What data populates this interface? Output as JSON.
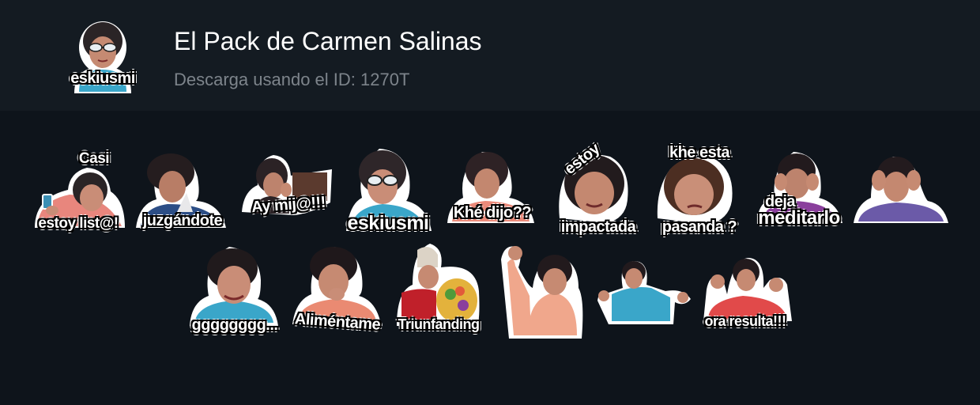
{
  "pack": {
    "title": "El Pack de Carmen Salinas",
    "subtitle": "Descarga usando el ID: 1270T",
    "icon_caption": "eskiusmi"
  },
  "stickers": [
    {
      "top": "Casi",
      "bottom": "estoy list@!"
    },
    {
      "top": "",
      "bottom": "juzgándote"
    },
    {
      "top": "",
      "bottom": "Ay mij@!!!"
    },
    {
      "top": "",
      "bottom": "eskiusmi"
    },
    {
      "top": "",
      "bottom": "Khé dijo??"
    },
    {
      "top": "estoy",
      "bottom": "impactada"
    },
    {
      "top": "khe esta",
      "bottom": "pasanda ?"
    },
    {
      "top": "deja",
      "bottom": "meditarlo"
    },
    {
      "top": "",
      "bottom": ""
    },
    {
      "top": "",
      "bottom": "gggggggg..."
    },
    {
      "top": "",
      "bottom": "Aliméntame"
    },
    {
      "top": "",
      "bottom": "Triunfanding"
    },
    {
      "top": "",
      "bottom": ""
    },
    {
      "top": "",
      "bottom": ""
    },
    {
      "top": "",
      "bottom": "ora resulta!!!"
    }
  ],
  "colors": {
    "background": "#0e141b",
    "header_background": "#141b22",
    "title": "#ffffff",
    "subtitle": "#7d848b",
    "sticker_outline": "#ffffff"
  },
  "icons": {
    "pack_icon": "carmen-salinas-sunglasses-sticker"
  }
}
